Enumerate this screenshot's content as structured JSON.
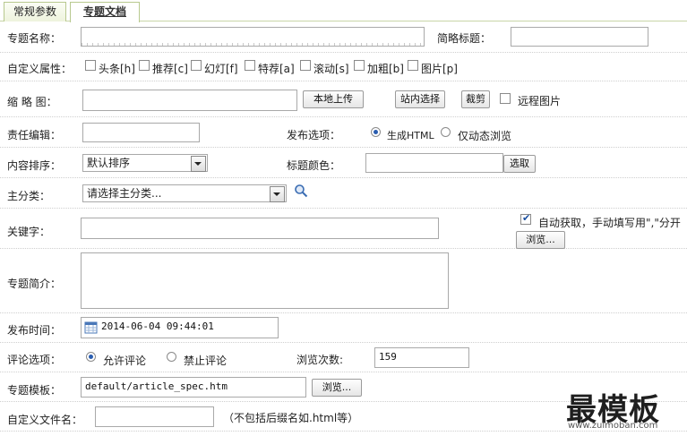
{
  "tabs": [
    {
      "label": "常规参数"
    },
    {
      "label": "专题文档"
    }
  ],
  "fields": {
    "title_label": "专题名称：",
    "short_title_label": "简略标题：",
    "attr_label": "自定义属性：",
    "attrs": [
      "头条[h]",
      "推荐[c]",
      "幻灯[f]",
      "特荐[a]",
      "滚动[s]",
      "加粗[b]",
      "图片[p]"
    ],
    "thumb_label": "缩 略 图：",
    "upload_btn": "本地上传",
    "site_select_btn": "站内选择",
    "crop_btn": "裁剪",
    "remote_label": "远程图片",
    "editor_label": "责任编辑：",
    "publish_label": "发布选项：",
    "publish_opt1": "生成HTML",
    "publish_opt2": "仅动态浏览",
    "sort_label": "内容排序：",
    "sort_value": "默认排序",
    "color_label": "标题颜色：",
    "color_btn": "选取",
    "category_label": "主分类：",
    "category_value": "请选择主分类...",
    "keywords_label": "关键字：",
    "auto_fetch_label": "自动获取，手动填写用\",\"分开",
    "browse_btn": "浏览...",
    "summary_label": "专题简介：",
    "pubtime_label": "发布时间：",
    "pubtime_value": "2014-06-04 09:44:01",
    "comment_label": "评论选项：",
    "comment_allow": "允许评论",
    "comment_deny": "禁止评论",
    "views_label": "浏览次数:",
    "views_value": "159",
    "template_label": "专题模板：",
    "template_value": "default/article_spec.htm",
    "template_browse_btn": "浏览...",
    "filename_label": "自定义文件名：",
    "filename_hint": "（不包括后缀名如.html等）"
  },
  "watermark": {
    "text": "最模板",
    "sub": "www.zuimoban.com"
  },
  "colors": {
    "tab_border": "#b8c98f",
    "checkbox_mark": "#1a4fa0",
    "radio_dot": "#2a5db0"
  }
}
